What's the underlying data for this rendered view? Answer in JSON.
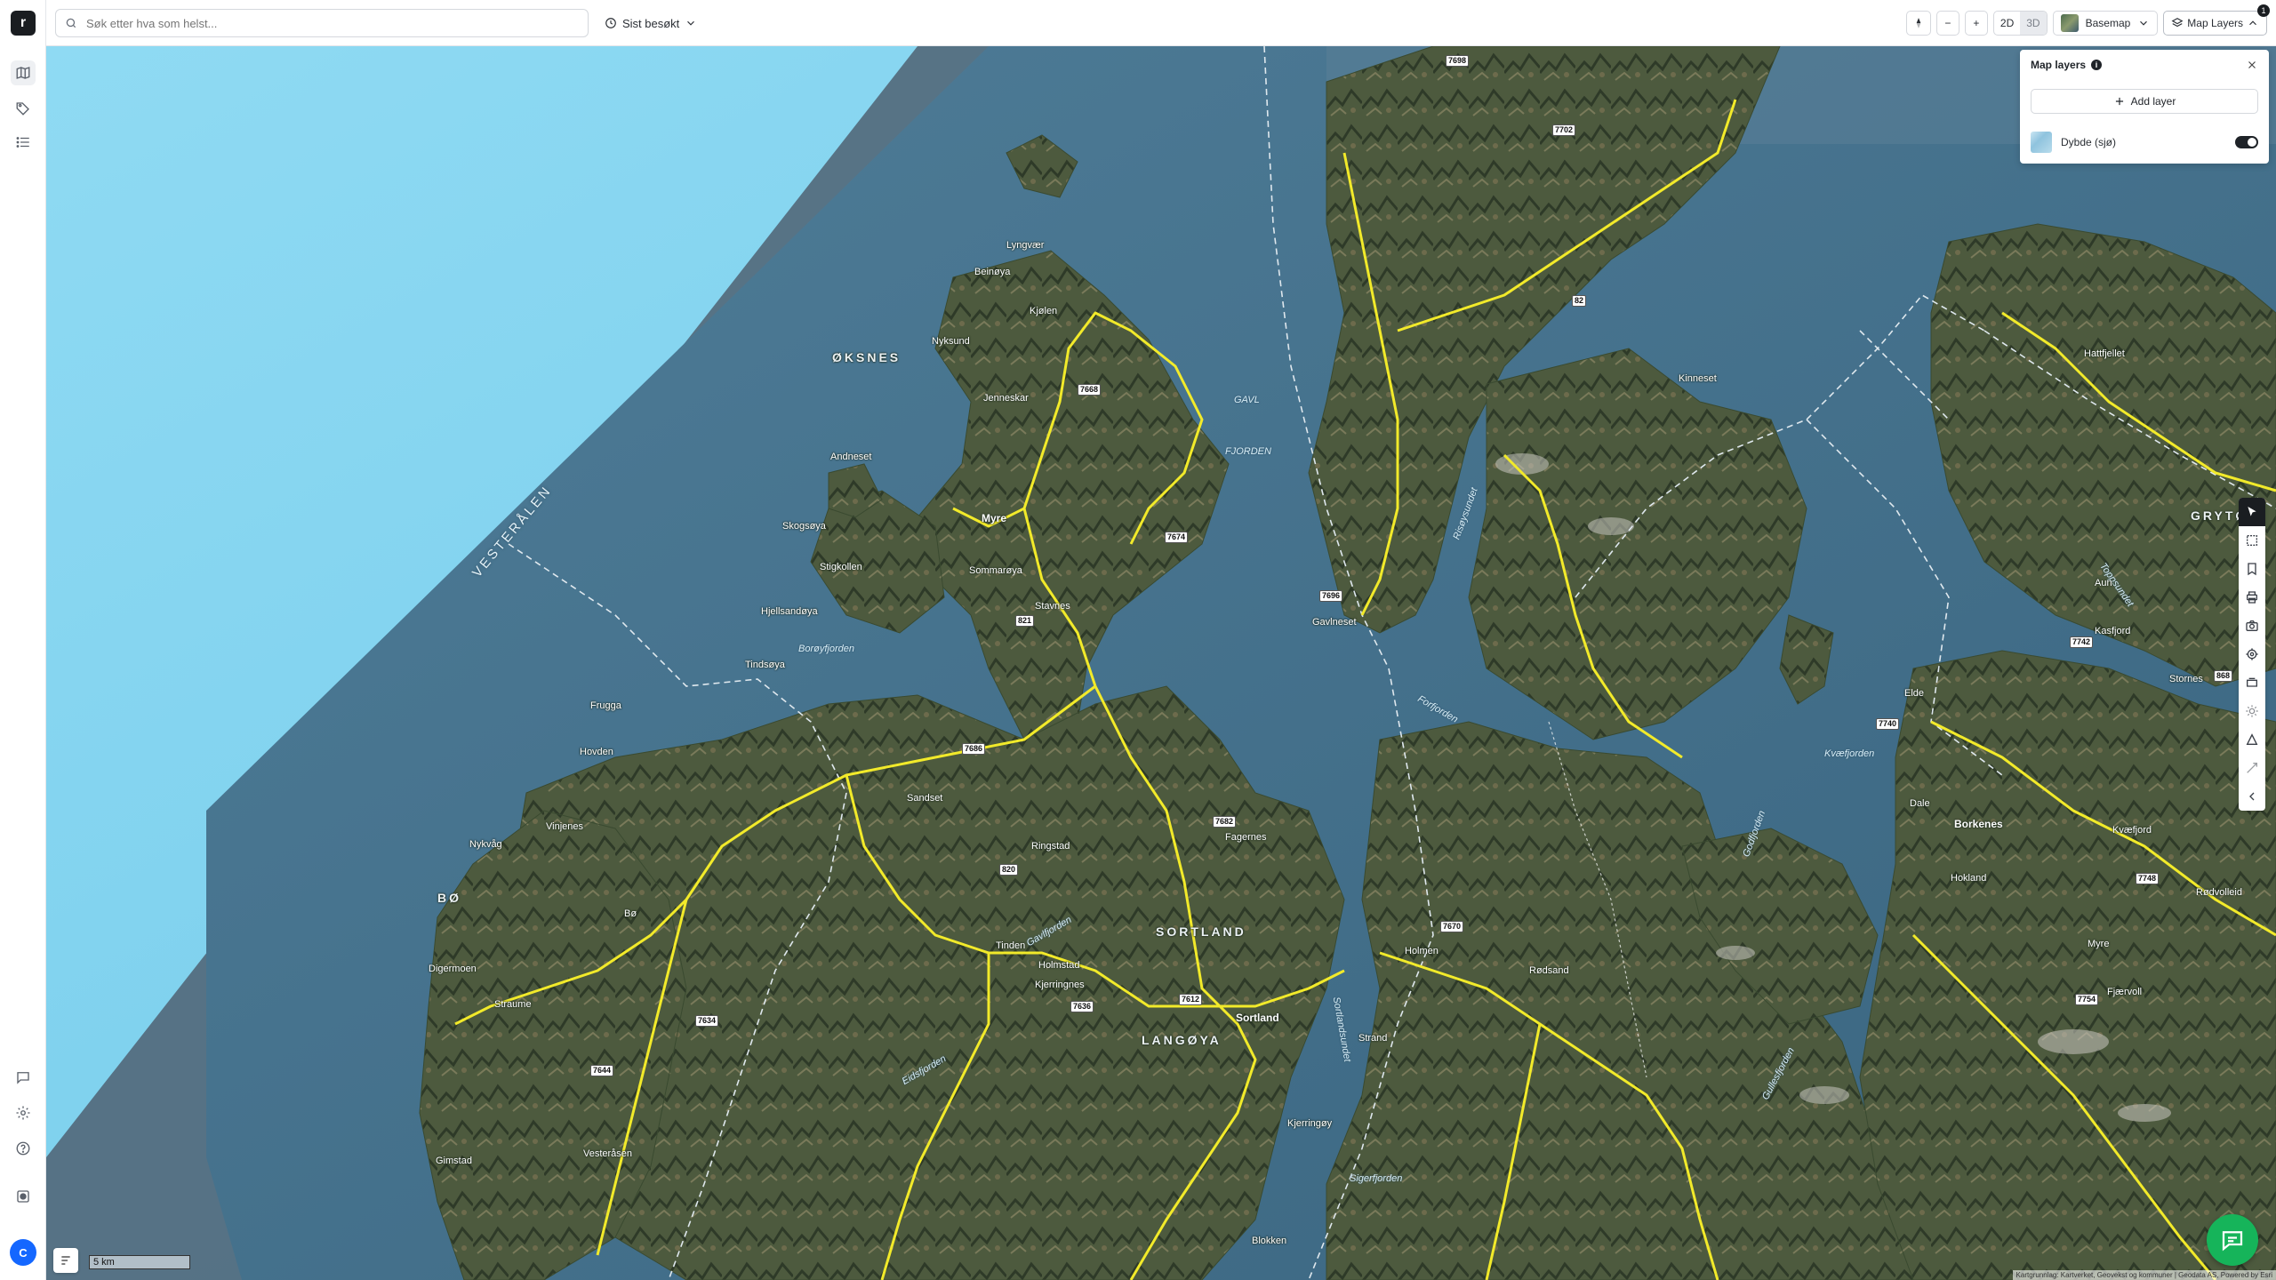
{
  "app": {
    "logo_letter": "r"
  },
  "search": {
    "placeholder": "Søk etter hva som helst..."
  },
  "recent": {
    "label": "Sist besøkt"
  },
  "view": {
    "mode_2d": "2D",
    "mode_3d": "3D",
    "active_mode": "3D"
  },
  "zoom": {
    "minus": "−",
    "plus": "+"
  },
  "basemap": {
    "label": "Basemap"
  },
  "layers_button": {
    "label": "Map Layers",
    "badge": "1"
  },
  "layer_panel": {
    "title": "Map layers",
    "add_label": "Add layer",
    "layers": [
      {
        "name": "Dybde (sjø)",
        "visible": true
      }
    ]
  },
  "user": {
    "initial": "C"
  },
  "scale": {
    "label": "5 km"
  },
  "attribution": "Kartgrunnlag: Kartverket, Geovekst og kommuner | Geodata AS, Powered by Esri",
  "colors": {
    "sea_shallow": "#7fd3f0",
    "sea_deep": "#2f5874",
    "land": "#4e5a3f",
    "roads": "#f2ea2a",
    "chat": "#16b45a"
  },
  "map_labels": {
    "regions": [
      "VESTERÅLEN",
      "ØKSNES",
      "BØ",
      "SORTLAND",
      "LANGØYA",
      "GRYTØY"
    ],
    "waters": [
      "GAVL",
      "FJORDEN",
      "Borøyfjorden",
      "Eidsfjorden",
      "Kvæfjorden",
      "Gullesfjorden",
      "Sigerfjorden",
      "Risøysundet",
      "Toppsundet",
      "Forfjorden",
      "Sortlandsundet",
      "Gavlfjorden",
      "Godfjorden"
    ],
    "places": [
      "Myre",
      "Sortland",
      "Borkenes",
      "Kinneset",
      "Lyngvær",
      "Beinøya",
      "Kjølen",
      "Nyksund",
      "Tindsøya",
      "Skogsøya",
      "Andneset",
      "Frugga",
      "Hovden",
      "Nykvåg",
      "Vinjenes",
      "Straume",
      "Bø",
      "Digermoen",
      "Gimstad",
      "Vesteråsen",
      "Fagernes",
      "Stavnes",
      "Sortland",
      "Holmstad",
      "Kjerringnes",
      "Blokken",
      "Kjerringøy",
      "Gavlneset",
      "Holmen",
      "Fjærvoll",
      "Kvæfjord",
      "Myre",
      "Elde",
      "Hokland",
      "Rødsand",
      "Strand",
      "Lyngvær",
      "Sommarøya",
      "Stigkollen",
      "Hjellsandøya",
      "Ringstad",
      "Sandset",
      "Tinden",
      "Jenneskar",
      "Hattfjellet",
      "Aun",
      "Stornes",
      "Kasfjord",
      "Dale",
      "Rødvolleid"
    ],
    "road_numbers": [
      "7698",
      "7702",
      "82",
      "7668",
      "7674",
      "821",
      "820",
      "7686",
      "7612",
      "7636",
      "7644",
      "7634",
      "7670",
      "7682",
      "7696",
      "7742",
      "7740",
      "7748",
      "7754",
      "868",
      "7698"
    ]
  }
}
